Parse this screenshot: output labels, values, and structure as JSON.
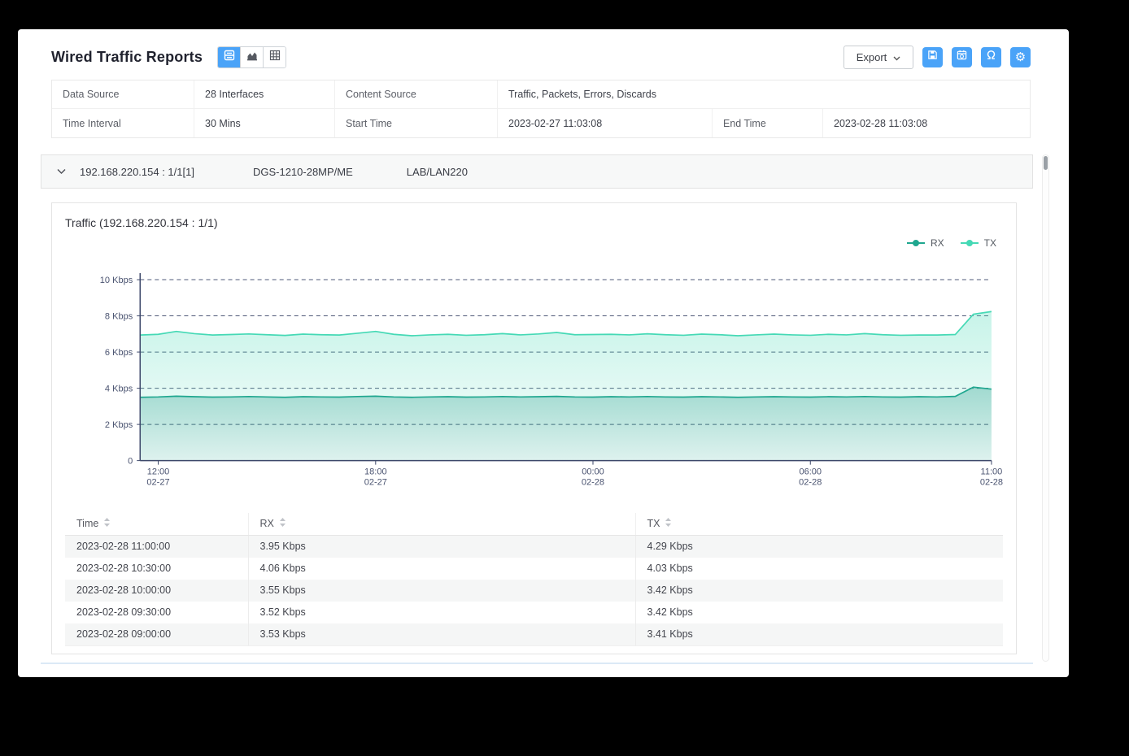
{
  "header": {
    "title": "Wired Traffic Reports",
    "view_modes": {
      "selected": "combined",
      "options": [
        "combined",
        "chart",
        "table"
      ]
    },
    "export_label": "Export",
    "action_icons": [
      "save",
      "schedule",
      "support",
      "settings"
    ]
  },
  "info": {
    "data_source_label": "Data Source",
    "data_source_value": "28 Interfaces",
    "content_source_label": "Content Source",
    "content_source_value": "Traffic, Packets, Errors, Discards",
    "time_interval_label": "Time Interval",
    "time_interval_value": "30 Mins",
    "start_time_label": "Start Time",
    "start_time_value": "2023-02-27 11:03:08",
    "end_time_label": "End Time",
    "end_time_value": "2023-02-28 11:03:08"
  },
  "section": {
    "interface": "192.168.220.154 : 1/1[1]",
    "device": "DGS-1210-28MP/ME",
    "location": "LAB/LAN220"
  },
  "chart_data": {
    "type": "area",
    "stacked": true,
    "title": "Traffic (192.168.220.154 : 1/1)",
    "ylabel": "Kbps",
    "ylim": [
      0,
      10
    ],
    "grid": "dashed",
    "legend_position": "top-right",
    "y_ticks": [
      {
        "v": 10,
        "label": "10 Kbps"
      },
      {
        "v": 8,
        "label": "8 Kbps"
      },
      {
        "v": 6,
        "label": "6 Kbps"
      },
      {
        "v": 4,
        "label": "4 Kbps"
      },
      {
        "v": 2,
        "label": "2 Kbps"
      },
      {
        "v": 0,
        "label": "0"
      }
    ],
    "x": [
      "02-27 11:30",
      "02-27 12:00",
      "02-27 12:30",
      "02-27 13:00",
      "02-27 13:30",
      "02-27 14:00",
      "02-27 14:30",
      "02-27 15:00",
      "02-27 15:30",
      "02-27 16:00",
      "02-27 16:30",
      "02-27 17:00",
      "02-27 17:30",
      "02-27 18:00",
      "02-27 18:30",
      "02-27 19:00",
      "02-27 19:30",
      "02-27 20:00",
      "02-27 20:30",
      "02-27 21:00",
      "02-27 21:30",
      "02-27 22:00",
      "02-27 22:30",
      "02-27 23:00",
      "02-27 23:30",
      "02-28 00:00",
      "02-28 00:30",
      "02-28 01:00",
      "02-28 01:30",
      "02-28 02:00",
      "02-28 02:30",
      "02-28 03:00",
      "02-28 03:30",
      "02-28 04:00",
      "02-28 04:30",
      "02-28 05:00",
      "02-28 05:30",
      "02-28 06:00",
      "02-28 06:30",
      "02-28 07:00",
      "02-28 07:30",
      "02-28 08:00",
      "02-28 08:30",
      "02-28 09:00",
      "02-28 09:30",
      "02-28 10:00",
      "02-28 10:30",
      "02-28 11:00"
    ],
    "x_ticks": [
      {
        "time": "02-27 12:00",
        "label": "12:00",
        "sub": "02-27"
      },
      {
        "time": "02-27 18:00",
        "label": "18:00",
        "sub": "02-27"
      },
      {
        "time": "02-28 00:00",
        "label": "00:00",
        "sub": "02-28"
      },
      {
        "time": "02-28 06:00",
        "label": "06:00",
        "sub": "02-28"
      },
      {
        "time": "02-28 11:00",
        "label": "11:00",
        "sub": "02-28"
      }
    ],
    "series": [
      {
        "name": "RX",
        "color": "#1fa78f",
        "values": [
          3.5,
          3.52,
          3.56,
          3.53,
          3.51,
          3.52,
          3.54,
          3.52,
          3.5,
          3.53,
          3.52,
          3.51,
          3.54,
          3.56,
          3.52,
          3.5,
          3.52,
          3.53,
          3.51,
          3.52,
          3.54,
          3.52,
          3.53,
          3.55,
          3.52,
          3.51,
          3.53,
          3.52,
          3.54,
          3.52,
          3.51,
          3.53,
          3.52,
          3.5,
          3.52,
          3.53,
          3.52,
          3.51,
          3.53,
          3.52,
          3.54,
          3.52,
          3.51,
          3.53,
          3.52,
          3.55,
          4.06,
          3.95
        ]
      },
      {
        "name": "TX",
        "color": "#45d9b5",
        "values": [
          3.44,
          3.46,
          3.58,
          3.49,
          3.43,
          3.45,
          3.46,
          3.44,
          3.42,
          3.46,
          3.44,
          3.43,
          3.5,
          3.58,
          3.46,
          3.4,
          3.43,
          3.45,
          3.42,
          3.44,
          3.48,
          3.43,
          3.47,
          3.53,
          3.44,
          3.46,
          3.45,
          3.43,
          3.47,
          3.44,
          3.42,
          3.46,
          3.44,
          3.4,
          3.43,
          3.46,
          3.43,
          3.42,
          3.45,
          3.43,
          3.48,
          3.44,
          3.42,
          3.41,
          3.42,
          3.42,
          4.03,
          4.29
        ]
      }
    ]
  },
  "table": {
    "headers": [
      {
        "label": "Time",
        "sortable": true
      },
      {
        "label": "RX",
        "sortable": true
      },
      {
        "label": "TX",
        "sortable": true
      }
    ],
    "rows": [
      [
        "2023-02-28 11:00:00",
        "3.95 Kbps",
        "4.29 Kbps"
      ],
      [
        "2023-02-28 10:30:00",
        "4.06 Kbps",
        "4.03 Kbps"
      ],
      [
        "2023-02-28 10:00:00",
        "3.55 Kbps",
        "3.42 Kbps"
      ],
      [
        "2023-02-28 09:30:00",
        "3.52 Kbps",
        "3.42 Kbps"
      ],
      [
        "2023-02-28 09:00:00",
        "3.53 Kbps",
        "3.41 Kbps"
      ]
    ]
  },
  "colors": {
    "accent": "#4aa3f8",
    "rx": "#1fa78f",
    "tx": "#45d9b5",
    "axis": "#3d486a",
    "row_stripe": "#f5f6f6"
  }
}
